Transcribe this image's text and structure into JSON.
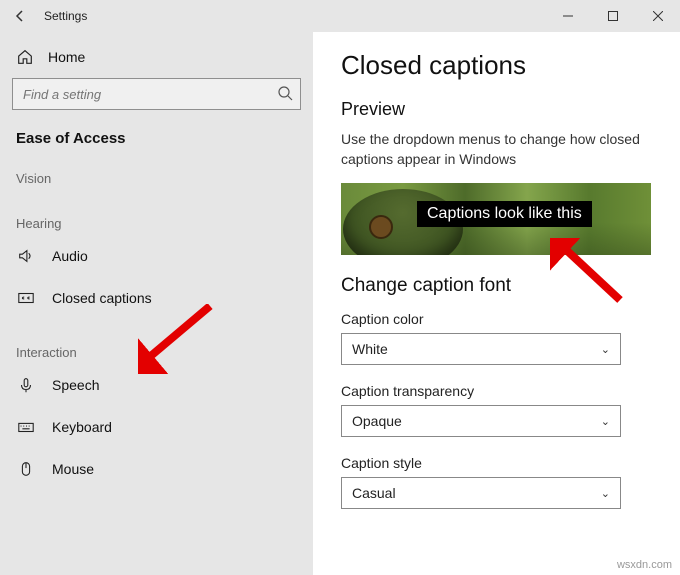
{
  "titlebar": {
    "title": "Settings"
  },
  "home": {
    "label": "Home"
  },
  "search": {
    "placeholder": "Find a setting"
  },
  "subheader": "Ease of Access",
  "categories": {
    "vision": "Vision",
    "hearing": "Hearing",
    "interaction": "Interaction"
  },
  "nav": {
    "audio": "Audio",
    "closed_captions": "Closed captions",
    "speech": "Speech",
    "keyboard": "Keyboard",
    "mouse": "Mouse"
  },
  "main": {
    "h1": "Closed captions",
    "preview_heading": "Preview",
    "preview_body": "Use the dropdown menus to change how closed captions appear in Windows",
    "caption_sample": "Captions look like this",
    "change_font_heading": "Change caption font",
    "fields": {
      "color": {
        "label": "Caption color",
        "value": "White"
      },
      "transparency": {
        "label": "Caption transparency",
        "value": "Opaque"
      },
      "style": {
        "label": "Caption style",
        "value": "Casual"
      }
    }
  },
  "watermark": "wsxdn.com"
}
